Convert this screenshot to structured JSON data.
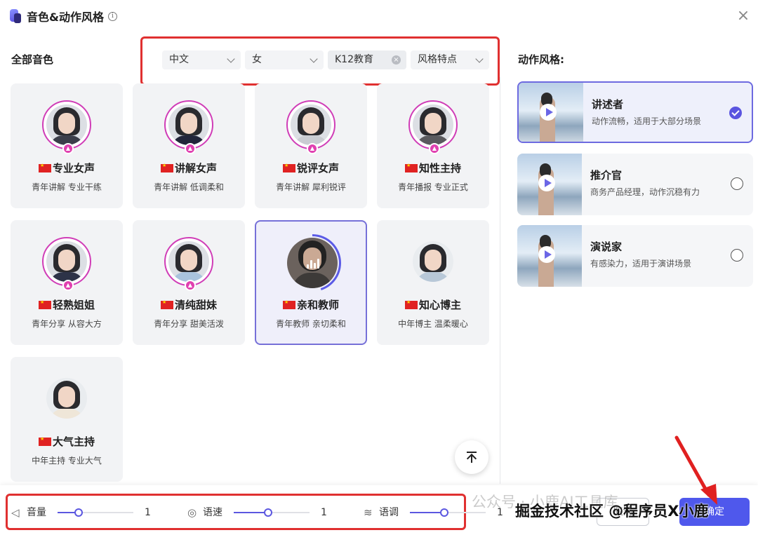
{
  "header": {
    "title": "音色&动作风格",
    "info_glyph": "i",
    "close_glyph": "×"
  },
  "voice_panel": {
    "title": "全部音色",
    "filters": [
      {
        "label": "中文",
        "type": "select"
      },
      {
        "label": "女",
        "type": "select"
      },
      {
        "label": "K12教育",
        "type": "tag"
      },
      {
        "label": "风格特点",
        "type": "select"
      }
    ],
    "voices": [
      {
        "name": "专业女声",
        "desc": "青年讲解 专业干练",
        "hot": true
      },
      {
        "name": "讲解女声",
        "desc": "青年讲解 低调柔和",
        "hot": true
      },
      {
        "name": "锐评女声",
        "desc": "青年讲解 犀利锐评",
        "hot": true
      },
      {
        "name": "知性主持",
        "desc": "青年播报 专业正式",
        "hot": true
      },
      {
        "name": "轻熟姐姐",
        "desc": "青年分享 从容大方",
        "hot": true
      },
      {
        "name": "清纯甜妹",
        "desc": "青年分享 甜美活泼",
        "hot": true
      },
      {
        "name": "亲和教师",
        "desc": "青年教师 亲切柔和",
        "hot": false,
        "selected": true,
        "playing": true
      },
      {
        "name": "知心博主",
        "desc": "中年博主 温柔暖心",
        "hot": false
      },
      {
        "name": "大气主持",
        "desc": "中年主持 专业大气",
        "hot": false
      }
    ]
  },
  "style_panel": {
    "title": "动作风格:",
    "styles": [
      {
        "title": "讲述者",
        "desc": "动作流畅，适用于大部分场景",
        "selected": true
      },
      {
        "title": "推介官",
        "desc": "商务产品经理，动作沉稳有力",
        "selected": false
      },
      {
        "title": "演说家",
        "desc": "有感染力，适用于演讲场景",
        "selected": false
      }
    ]
  },
  "bottom": {
    "sliders": [
      {
        "label": "音量",
        "value": "1",
        "icon": "speaker-icon",
        "level": 0.28
      },
      {
        "label": "语速",
        "value": "1",
        "icon": "speed-icon",
        "level": 0.45
      },
      {
        "label": "语调",
        "value": "1",
        "icon": "pitch-icon",
        "level": 0.45
      }
    ],
    "cancel_label": "取消",
    "confirm_label": "确定"
  },
  "watermark": {
    "text": "公众号 · 小鹿AI工具库",
    "overlay": "掘金技术社区 @程序员X小鹿"
  },
  "colors": {
    "accent": "#5b57e0",
    "highlight_red": "#e03030",
    "hot_badge": "#e040b0"
  }
}
